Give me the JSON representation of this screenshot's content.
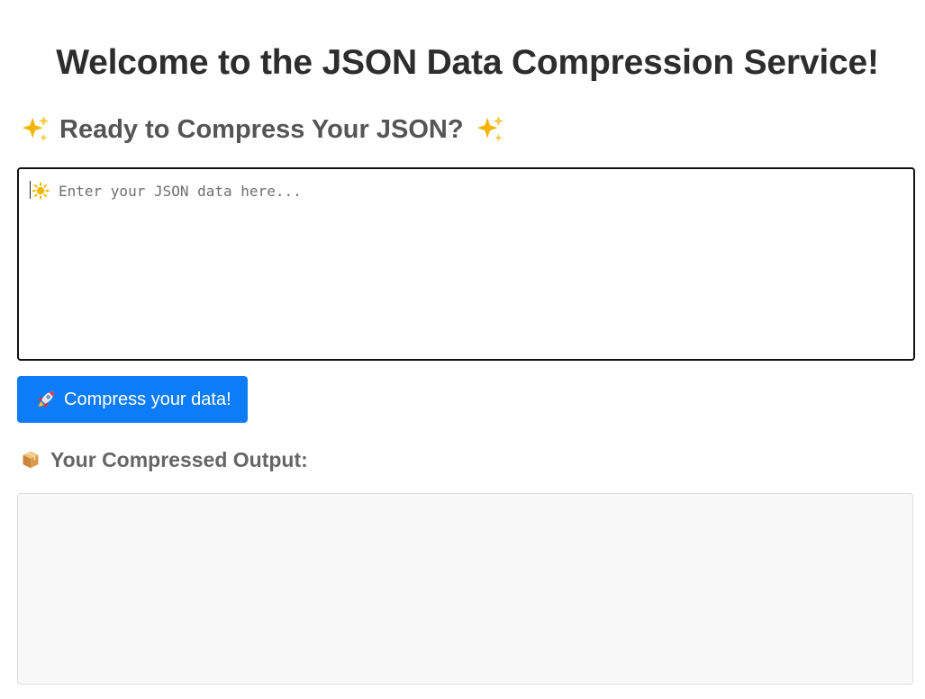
{
  "page": {
    "title": "Welcome to the JSON Data Compression Service!"
  },
  "subtitle": {
    "text": "Ready to Compress Your JSON?",
    "left_icon": "sparkle-icon",
    "right_icon": "sparkle-icon"
  },
  "input": {
    "value": "",
    "placeholder": "Enter your JSON data here...",
    "icon": "sun-icon"
  },
  "compress_button": {
    "label": "Compress your data!",
    "icon": "rocket-icon",
    "color": "#0d7cf8"
  },
  "output": {
    "heading": "Your Compressed Output:",
    "icon": "package-icon",
    "value": ""
  }
}
